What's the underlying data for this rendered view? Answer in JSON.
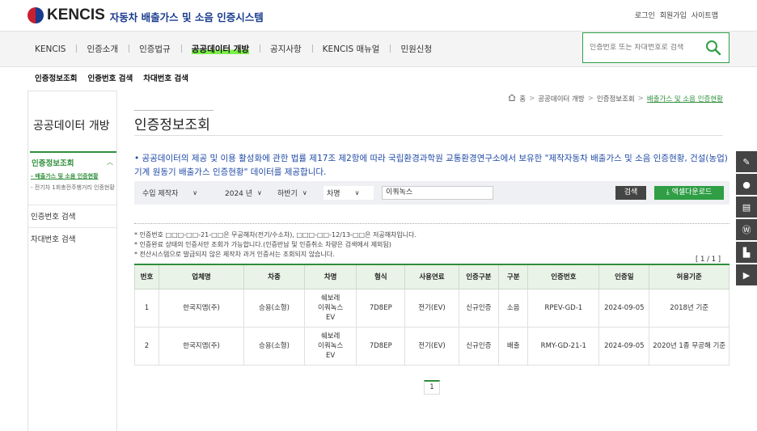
{
  "header": {
    "logo_text": "KENCIS",
    "logo_sub": "자동차 배출가스 및 소음 인증시스템",
    "utils": [
      "로그인",
      "회원가입",
      "사이트맵"
    ]
  },
  "nav": {
    "items": [
      "KENCIS",
      "인증소개",
      "인증법규",
      "공공데이터 개방",
      "공지사항",
      "KENCIS 매뉴얼",
      "민원신청"
    ],
    "active_index": 3,
    "search_placeholder": "인증번호 또는 차대번호로 검색"
  },
  "subnav": [
    "인증정보조회",
    "인증번호 검색",
    "차대번호 검색"
  ],
  "sidebar": {
    "title": "공공데이터 개방",
    "category": "인증정보조회",
    "sub1": "- 배출가스 및 소음 인증현황",
    "sub2": "- 전기차 1회충전주행거리 인증현황",
    "item1": "인증번호 검색",
    "item2": "차대번호 검색"
  },
  "breadcrumb": [
    "홈",
    "공공데이터 개방",
    "인증정보조회",
    "배출가스 및 소음 인증현황"
  ],
  "page_title": "인증정보조회",
  "intro": "• 공공데이터의 제공 및 이용 활성화에 관한 법률 제17조 제2항에 따라 국립환경과학원 교통환경연구소에서 보유한 \"제작자동차 배출가스 및 소음 인증현황, 건설(농업)기계 원동기 배출가스 인증현황\" 데이터를 제공합니다.",
  "filters": {
    "type": "수입 제작자",
    "year": "2024 년",
    "half": "하반기",
    "field": "차명",
    "keyword": "이쿼녹스",
    "search_label": "검색",
    "excel_label": "엑셀다운로드"
  },
  "notes": [
    "* 인증번호 □□□-□□-21-□□은 무공해차(전기/수소차), □□□-□□-12/13-□□은 저공해차입니다.",
    "* 인증완료 상태의 인증서만 조회가 가능합니다.(인증반납 및 인증취소 차량은 검색에서 제외됨)",
    "* 전산시스템으로 발급되지 않은 제작차 과거 인증서는 조회되지 않습니다."
  ],
  "page_info": "[ 1 / 1 ]",
  "table": {
    "headers": [
      "번호",
      "업체명",
      "차종",
      "차명",
      "형식",
      "사용연료",
      "인증구분",
      "구분",
      "인증번호",
      "인증일",
      "허용기준"
    ],
    "rows": [
      [
        "1",
        "한국지엠(주)",
        "승용(소형)",
        "쉐보레\n이쿼녹스\nEV",
        "7D8EP",
        "전기(EV)",
        "신규인증",
        "소음",
        "RPEV-GD-1",
        "2024-09-05",
        "2018년 기준"
      ],
      [
        "2",
        "한국지엠(주)",
        "승용(소형)",
        "쉐보레\n이쿼녹스\nEV",
        "7D8EP",
        "전기(EV)",
        "신규인증",
        "배출",
        "RMY-GD-21-1",
        "2024-09-05",
        "2020년 1종 무공해 기준"
      ]
    ]
  },
  "pager": "1",
  "colors": {
    "green": "#2f8f3b",
    "blue": "#1f4aa6",
    "highlight": "#7cf04a"
  }
}
